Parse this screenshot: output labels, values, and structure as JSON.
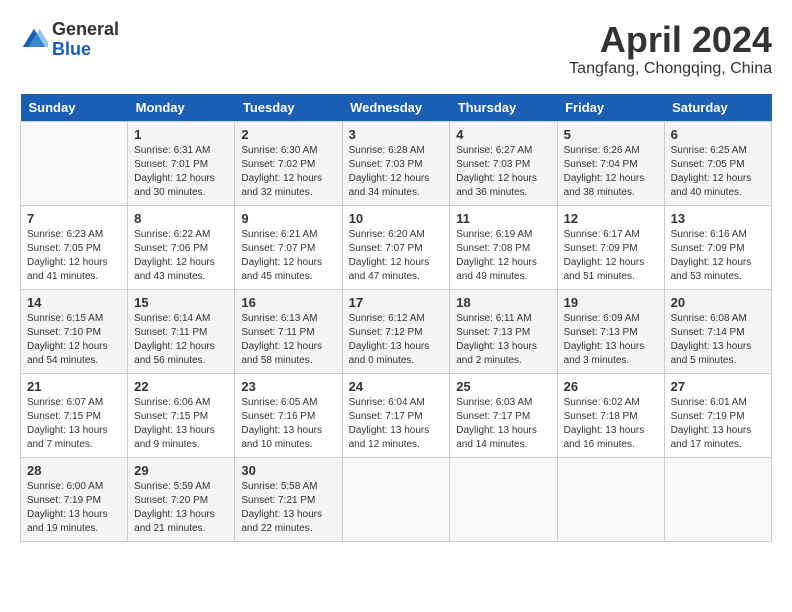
{
  "logo": {
    "general": "General",
    "blue": "Blue"
  },
  "title": "April 2024",
  "subtitle": "Tangfang, Chongqing, China",
  "days_header": [
    "Sunday",
    "Monday",
    "Tuesday",
    "Wednesday",
    "Thursday",
    "Friday",
    "Saturday"
  ],
  "weeks": [
    [
      {
        "day": "",
        "info": ""
      },
      {
        "day": "1",
        "info": "Sunrise: 6:31 AM\nSunset: 7:01 PM\nDaylight: 12 hours\nand 30 minutes."
      },
      {
        "day": "2",
        "info": "Sunrise: 6:30 AM\nSunset: 7:02 PM\nDaylight: 12 hours\nand 32 minutes."
      },
      {
        "day": "3",
        "info": "Sunrise: 6:28 AM\nSunset: 7:03 PM\nDaylight: 12 hours\nand 34 minutes."
      },
      {
        "day": "4",
        "info": "Sunrise: 6:27 AM\nSunset: 7:03 PM\nDaylight: 12 hours\nand 36 minutes."
      },
      {
        "day": "5",
        "info": "Sunrise: 6:26 AM\nSunset: 7:04 PM\nDaylight: 12 hours\nand 38 minutes."
      },
      {
        "day": "6",
        "info": "Sunrise: 6:25 AM\nSunset: 7:05 PM\nDaylight: 12 hours\nand 40 minutes."
      }
    ],
    [
      {
        "day": "7",
        "info": "Sunrise: 6:23 AM\nSunset: 7:05 PM\nDaylight: 12 hours\nand 41 minutes."
      },
      {
        "day": "8",
        "info": "Sunrise: 6:22 AM\nSunset: 7:06 PM\nDaylight: 12 hours\nand 43 minutes."
      },
      {
        "day": "9",
        "info": "Sunrise: 6:21 AM\nSunset: 7:07 PM\nDaylight: 12 hours\nand 45 minutes."
      },
      {
        "day": "10",
        "info": "Sunrise: 6:20 AM\nSunset: 7:07 PM\nDaylight: 12 hours\nand 47 minutes."
      },
      {
        "day": "11",
        "info": "Sunrise: 6:19 AM\nSunset: 7:08 PM\nDaylight: 12 hours\nand 49 minutes."
      },
      {
        "day": "12",
        "info": "Sunrise: 6:17 AM\nSunset: 7:09 PM\nDaylight: 12 hours\nand 51 minutes."
      },
      {
        "day": "13",
        "info": "Sunrise: 6:16 AM\nSunset: 7:09 PM\nDaylight: 12 hours\nand 53 minutes."
      }
    ],
    [
      {
        "day": "14",
        "info": "Sunrise: 6:15 AM\nSunset: 7:10 PM\nDaylight: 12 hours\nand 54 minutes."
      },
      {
        "day": "15",
        "info": "Sunrise: 6:14 AM\nSunset: 7:11 PM\nDaylight: 12 hours\nand 56 minutes."
      },
      {
        "day": "16",
        "info": "Sunrise: 6:13 AM\nSunset: 7:11 PM\nDaylight: 12 hours\nand 58 minutes."
      },
      {
        "day": "17",
        "info": "Sunrise: 6:12 AM\nSunset: 7:12 PM\nDaylight: 13 hours\nand 0 minutes."
      },
      {
        "day": "18",
        "info": "Sunrise: 6:11 AM\nSunset: 7:13 PM\nDaylight: 13 hours\nand 2 minutes."
      },
      {
        "day": "19",
        "info": "Sunrise: 6:09 AM\nSunset: 7:13 PM\nDaylight: 13 hours\nand 3 minutes."
      },
      {
        "day": "20",
        "info": "Sunrise: 6:08 AM\nSunset: 7:14 PM\nDaylight: 13 hours\nand 5 minutes."
      }
    ],
    [
      {
        "day": "21",
        "info": "Sunrise: 6:07 AM\nSunset: 7:15 PM\nDaylight: 13 hours\nand 7 minutes."
      },
      {
        "day": "22",
        "info": "Sunrise: 6:06 AM\nSunset: 7:15 PM\nDaylight: 13 hours\nand 9 minutes."
      },
      {
        "day": "23",
        "info": "Sunrise: 6:05 AM\nSunset: 7:16 PM\nDaylight: 13 hours\nand 10 minutes."
      },
      {
        "day": "24",
        "info": "Sunrise: 6:04 AM\nSunset: 7:17 PM\nDaylight: 13 hours\nand 12 minutes."
      },
      {
        "day": "25",
        "info": "Sunrise: 6:03 AM\nSunset: 7:17 PM\nDaylight: 13 hours\nand 14 minutes."
      },
      {
        "day": "26",
        "info": "Sunrise: 6:02 AM\nSunset: 7:18 PM\nDaylight: 13 hours\nand 16 minutes."
      },
      {
        "day": "27",
        "info": "Sunrise: 6:01 AM\nSunset: 7:19 PM\nDaylight: 13 hours\nand 17 minutes."
      }
    ],
    [
      {
        "day": "28",
        "info": "Sunrise: 6:00 AM\nSunset: 7:19 PM\nDaylight: 13 hours\nand 19 minutes."
      },
      {
        "day": "29",
        "info": "Sunrise: 5:59 AM\nSunset: 7:20 PM\nDaylight: 13 hours\nand 21 minutes."
      },
      {
        "day": "30",
        "info": "Sunrise: 5:58 AM\nSunset: 7:21 PM\nDaylight: 13 hours\nand 22 minutes."
      },
      {
        "day": "",
        "info": ""
      },
      {
        "day": "",
        "info": ""
      },
      {
        "day": "",
        "info": ""
      },
      {
        "day": "",
        "info": ""
      }
    ]
  ]
}
